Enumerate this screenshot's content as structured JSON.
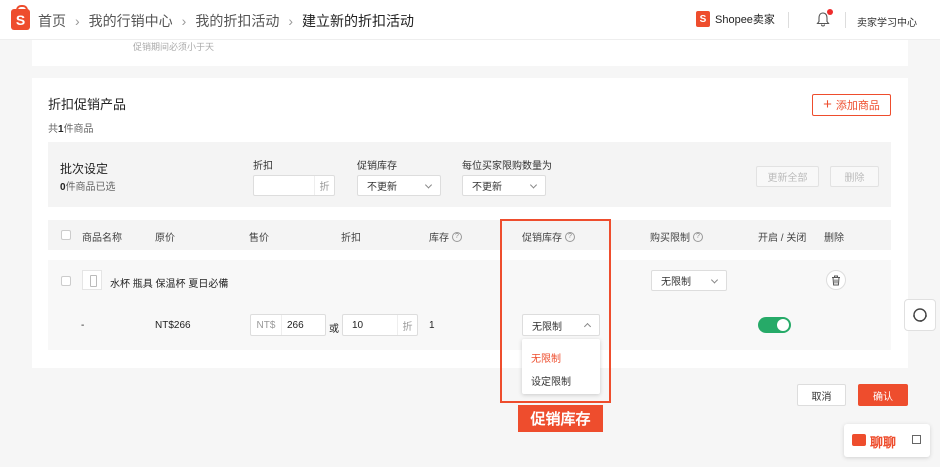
{
  "breadcrumb": {
    "items": [
      "首页",
      "我的行销中心",
      "我的折扣活动"
    ],
    "current": "建立新的折扣活动"
  },
  "header": {
    "logo_letter": "S",
    "brand_label": "Shopee卖家",
    "learn_label": "卖家学习中心"
  },
  "top_card": {
    "note": "促销期间必须小于天"
  },
  "section": {
    "title": "折扣促销产品",
    "count_prefix": "共",
    "count": "1",
    "count_suffix": "件商品",
    "add_label": "添加商品"
  },
  "batch": {
    "title": "批次设定",
    "selected_count": "0",
    "selected_suffix": "件商品已选",
    "discount_label": "折扣",
    "discount_suffix": "折",
    "stock_label": "促销库存",
    "stock_value": "不更新",
    "limit_label": "每位买家限购数量为",
    "limit_value": "不更新",
    "update_all": "更新全部",
    "delete": "删除"
  },
  "table": {
    "columns": [
      "商品名称",
      "原价",
      "售价",
      "折扣",
      "库存",
      "促销库存",
      "购买限制",
      "开启 / 关闭",
      "删除"
    ],
    "product": {
      "name": "水杯 瓶具 保温杯 夏日必備",
      "variation": "-",
      "original_price": "NT$266",
      "currency_prefix": "NT$",
      "sale_price": "266",
      "or_label": "或",
      "discount": "10",
      "discount_suffix": "折",
      "stock": "1",
      "promo_stock_value": "无限制",
      "purchase_limit": "无限制",
      "enabled": true
    }
  },
  "dropdown": {
    "options": [
      "无限制",
      "设定限制"
    ],
    "selected": "无限制"
  },
  "annotation": {
    "label": "促销库存"
  },
  "footer": {
    "cancel": "取消",
    "confirm": "确认"
  },
  "chat": {
    "label": "聊聊"
  },
  "colors": {
    "brand": "#ee4d2d",
    "toggle_on": "#26aa68"
  }
}
